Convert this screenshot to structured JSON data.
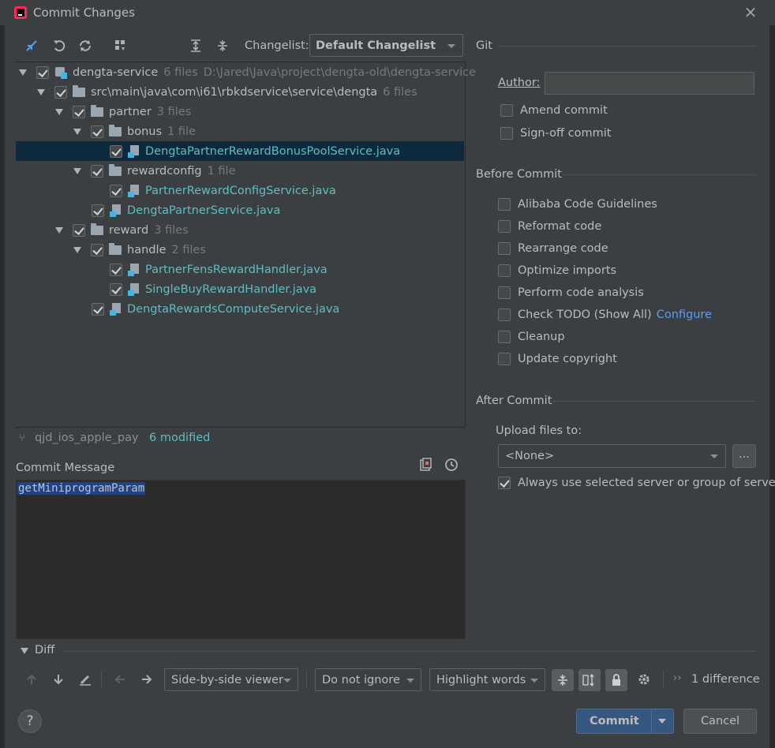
{
  "window": {
    "title": "Commit Changes",
    "close": "×"
  },
  "toolbar": {
    "changelist_label": "Changelist:",
    "changelist_value": "Default Changelist"
  },
  "tree": {
    "rows": [
      {
        "name": "dengta-service",
        "count": "6 files",
        "path": "D:\\Jared\\Java\\project\\dengta-old\\dengta-service"
      },
      {
        "name": "src\\main\\java\\com\\i61\\rbkdservice\\service\\dengta",
        "count": "6 files"
      },
      {
        "name": "partner",
        "count": "3 files"
      },
      {
        "name": "bonus",
        "count": "1 file"
      },
      {
        "name": "DengtaPartnerRewardBonusPoolService.java"
      },
      {
        "name": "rewardconfig",
        "count": "1 file"
      },
      {
        "name": "PartnerRewardConfigService.java"
      },
      {
        "name": "DengtaPartnerService.java"
      },
      {
        "name": "reward",
        "count": "3 files"
      },
      {
        "name": "handle",
        "count": "2 files"
      },
      {
        "name": "PartnerFensRewardHandler.java"
      },
      {
        "name": "SingleBuyRewardHandler.java"
      },
      {
        "name": "DengtaRewardsComputeService.java"
      }
    ]
  },
  "status": {
    "branch": "qjd_ios_apple_pay",
    "modified": "6 modified"
  },
  "commit_message": {
    "label": "Commit Message",
    "text": "getMiniprogramParam"
  },
  "git": {
    "title": "Git",
    "author_label": "Author:",
    "author_value": "",
    "amend": "Amend commit",
    "signoff": "Sign-off commit"
  },
  "before_commit": {
    "title": "Before Commit",
    "items": [
      "Alibaba Code Guidelines",
      "Reformat code",
      "Rearrange code",
      "Optimize imports",
      "Perform code analysis",
      "Check TODO (Show All)",
      "Cleanup",
      "Update copyright"
    ],
    "configure_link": "Configure"
  },
  "after_commit": {
    "title": "After Commit",
    "upload_label": "Upload files to:",
    "upload_value": "<None>",
    "browse": "...",
    "always_use": "Always use selected server or group of servers"
  },
  "diff": {
    "title": "Diff",
    "viewer": "Side-by-side viewer",
    "ignore": "Do not ignore",
    "highlight": "Highlight words",
    "count": "1 difference",
    "more": "››"
  },
  "buttons": {
    "help": "?",
    "commit": "Commit",
    "cancel": "Cancel"
  }
}
